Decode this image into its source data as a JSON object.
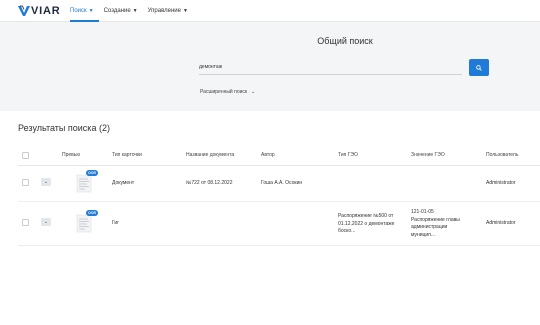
{
  "header": {
    "logo_text": "VIAR",
    "nav": [
      {
        "label": "Поиск"
      },
      {
        "label": "Создание"
      },
      {
        "label": "Управление"
      }
    ]
  },
  "search": {
    "title": "Общий поиск",
    "value": "демонтаж",
    "advanced_label": "Расширенный поиск"
  },
  "results": {
    "title": "Результаты поиска (2)",
    "columns": [
      "Превью",
      "Тип карточки",
      "Название документа",
      "Автор",
      "Тип ГЭО",
      "Значение ГЭО",
      "Пользователь"
    ],
    "ocr_badge": "OCR",
    "rows": [
      {
        "card_type": "Документ",
        "doc_name": "№722 от 08.12.2022",
        "author": "Гоша А.А. Осокин",
        "geo_type": "",
        "geo_value": [
          "",
          "",
          "",
          ""
        ],
        "user": "Administrator"
      },
      {
        "card_type": "Гиг",
        "doc_name": "",
        "author": "",
        "geo_type": [
          "Распоряжение №500 от",
          "01.12.2022 о демонтаже",
          "боско..."
        ],
        "geo_value": [
          "121-01-05",
          "Распоряжение главы",
          "администрации",
          "муницип..."
        ],
        "user": "Administrator"
      }
    ]
  },
  "colors": {
    "accent": "#1f7ad8",
    "panel": "#f4f5f7"
  },
  "icons": {
    "search": "search-icon",
    "caret": "chevron-down-icon",
    "doc": "document-thumbnail-icon"
  }
}
